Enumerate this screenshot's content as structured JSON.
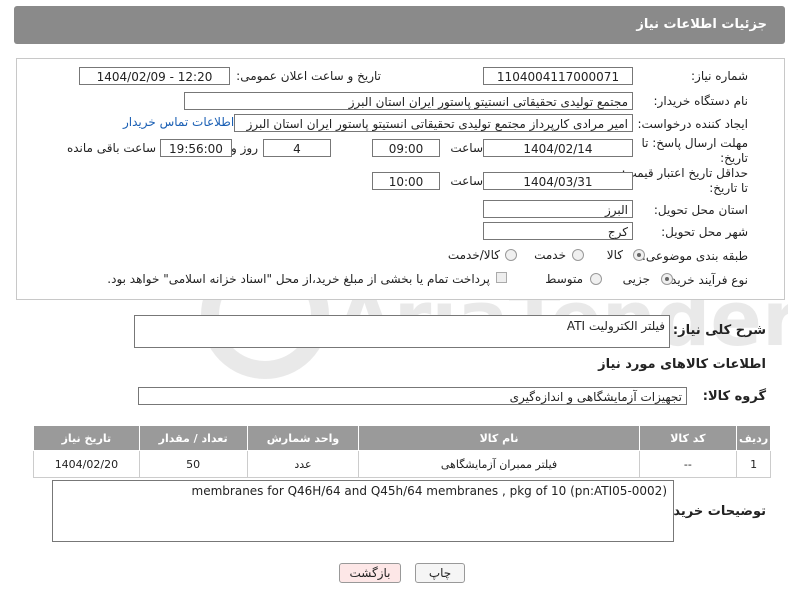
{
  "header": {
    "title": "جزئیات اطلاعات نیاز"
  },
  "form": {
    "need_number_label": "شماره نیاز:",
    "need_number": "1104004117000071",
    "announce_label": "تاریخ و ساعت اعلان عمومی:",
    "announce_value": "1404/02/09 - 12:20",
    "buyer_org_label": "نام دستگاه خریدار:",
    "buyer_org": "مجتمع تولیدی تحقیقاتی انستیتو پاستور ایران استان البرز",
    "requester_label": "ایجاد کننده درخواست:",
    "requester": "امیر مرادی کارپرداز مجتمع تولیدی تحقیقاتی انستیتو پاستور ایران استان البرز",
    "contact_link": "اطلاعات تماس خریدار",
    "reply_deadline_label_1": "مهلت ارسال پاسخ: تا",
    "reply_deadline_label_2": "تاریخ:",
    "reply_date": "1404/02/14",
    "time_label": "ساعت",
    "reply_time": "09:00",
    "days": "4",
    "days_label": "روز و",
    "remaining_time": "19:56:00",
    "remaining_label": "ساعت باقی مانده",
    "price_deadline_label_1": "حداقل تاریخ اعتبار قیمت:",
    "price_deadline_label_2": "تا تاریخ:",
    "price_date": "1404/03/31",
    "price_time": "10:00",
    "province_label": "استان محل تحویل:",
    "province": "البرز",
    "city_label": "شهر محل تحویل:",
    "city": "کرج",
    "category_label": "طبقه بندی موضوعی:",
    "category_options": [
      "کالا",
      "خدمت",
      "کالا/خدمت"
    ],
    "category_selected": "کالا",
    "process_label": "نوع فرآیند خرید :",
    "process_options": [
      "جزیی",
      "متوسط"
    ],
    "process_selected": "جزیی",
    "payment_note": "پرداخت تمام یا بخشی از مبلغ خرید،از محل \"اسناد خزانه اسلامی\" خواهد بود."
  },
  "summary": {
    "label": "شرح کلی نیاز:",
    "value": "فیلتر الکترولیت ATI"
  },
  "goods_section": {
    "title": "اطلاعات کالاهای مورد نیاز",
    "group_label": "گروه کالا:",
    "group_value": "تجهیزات آزمایشگاهی و اندازه‌گیری"
  },
  "table": {
    "headers": [
      "ردیف",
      "کد کالا",
      "نام کالا",
      "واحد شمارش",
      "تعداد / مقدار",
      "تاریخ نیاز"
    ],
    "rows": [
      [
        "1",
        "--",
        "فیلتر ممبران آزمایشگاهی",
        "عدد",
        "50",
        "1404/02/20"
      ]
    ]
  },
  "buyer_notes": {
    "label": "توضیحات خریدار:",
    "value": "membranes for Q46H/64  and Q45h/64 membranes , pkg of 10 (pn:ATI05-0002)"
  },
  "buttons": {
    "print": "چاپ",
    "back": "بازگشت"
  },
  "watermark": {
    "text": "AriaTender.neT"
  },
  "colors": {
    "header_bg": "#8a8a8a",
    "table_header_bg": "#9a9a9a",
    "link": "#1a5fb4",
    "back_button_bg": "#fde7e7"
  }
}
